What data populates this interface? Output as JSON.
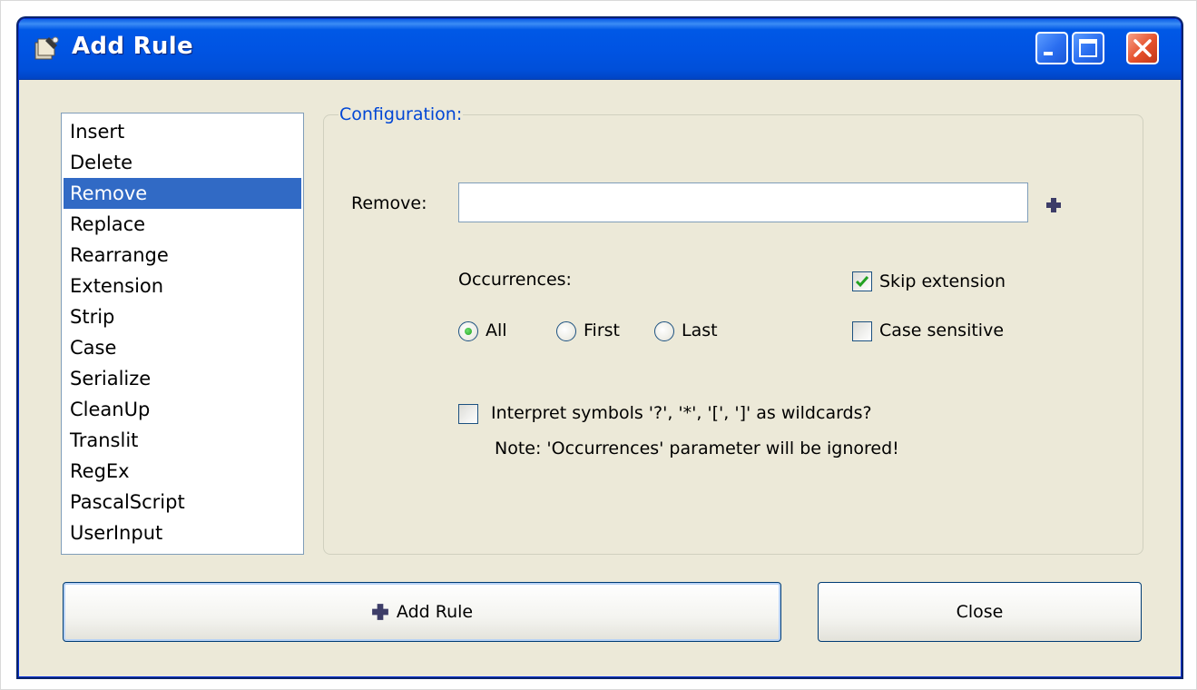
{
  "window": {
    "title": "Add Rule",
    "title_icon": "rule-wizard-icon",
    "controls": [
      "minimize-icon",
      "maximize-icon",
      "close-icon"
    ]
  },
  "rule_list": {
    "items": [
      "Insert",
      "Delete",
      "Remove",
      "Replace",
      "Rearrange",
      "Extension",
      "Strip",
      "Case",
      "Serialize",
      "CleanUp",
      "Translit",
      "RegEx",
      "PascalScript",
      "UserInput"
    ],
    "selected": "Remove"
  },
  "config": {
    "legend": "Configuration:",
    "remove_label": "Remove:",
    "remove_value": "",
    "add_icon": "plus-icon",
    "occurrences_label": "Occurrences:",
    "occurrences": {
      "all": "All",
      "first": "First",
      "last": "Last",
      "selected": "All"
    },
    "skip_extension": {
      "label": "Skip extension",
      "checked": true
    },
    "case_sensitive": {
      "label": "Case sensitive",
      "checked": false
    },
    "wildcards": {
      "label": "Interpret symbols '?', '*', '[', ']' as wildcards?",
      "checked": false
    },
    "note": "Note: 'Occurrences' parameter will be ignored!"
  },
  "buttons": {
    "add_rule": "Add Rule",
    "add_rule_icon": "plus-icon",
    "close": "Close"
  },
  "colors": {
    "titlebar": "#0054e3",
    "selection": "#316ac5",
    "legend_text": "#0046d5",
    "window_bg": "#ece9d8",
    "plus_icon": "#3d3d68"
  }
}
